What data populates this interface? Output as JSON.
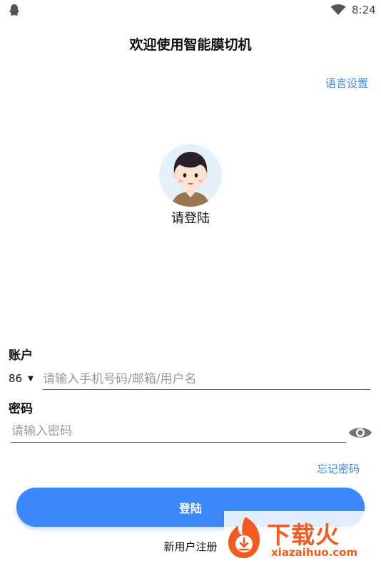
{
  "status_bar": {
    "time": "8:24"
  },
  "header": {
    "title": "欢迎使用智能膜切机",
    "language_link": "语言设置"
  },
  "profile": {
    "prompt": "请登陆"
  },
  "account": {
    "label": "账户",
    "country_code": "86",
    "placeholder": "请输入手机号码/邮箱/用户名",
    "value": ""
  },
  "password": {
    "label": "密码",
    "placeholder": "请输入密码",
    "value": ""
  },
  "forgot_link": "忘记密码",
  "login_button": "登陆",
  "register_link": "新用户注册",
  "watermark": {
    "brand": "下载火",
    "domain": "xiazaihuo.com"
  },
  "colors": {
    "accent": "#3c88fa",
    "link": "#3d86f3"
  },
  "icons": [
    "qq-icon",
    "wifi-icon",
    "avatar",
    "caret-down-icon",
    "eye-icon",
    "watermark-logo"
  ]
}
